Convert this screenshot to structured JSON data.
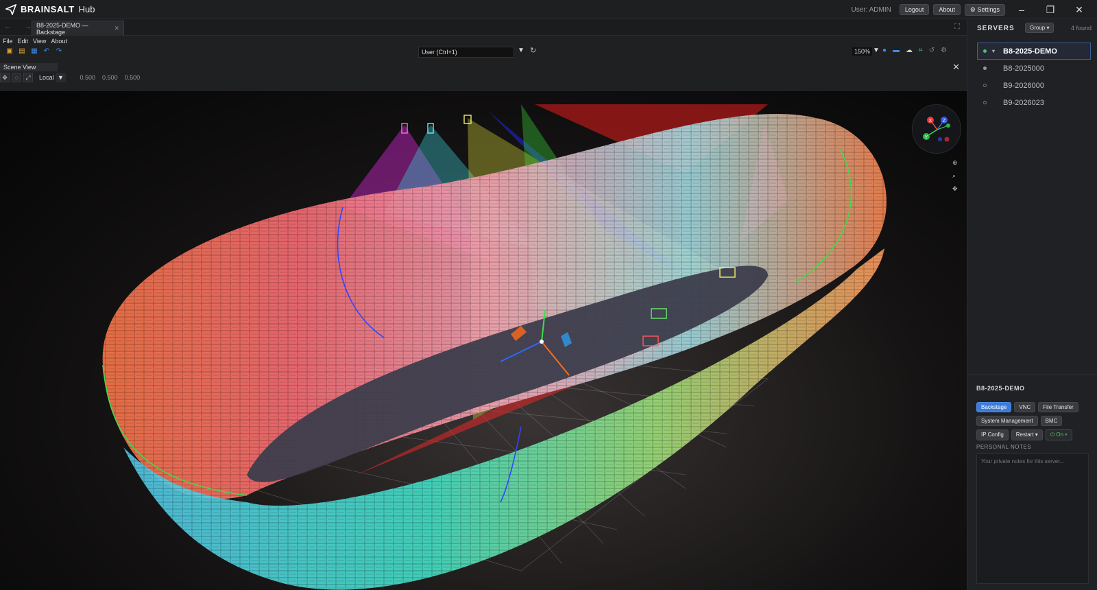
{
  "app": {
    "brand_bold": "BRAINSALT",
    "brand_light": "Hub"
  },
  "titlebar": {
    "user": "User: ADMIN",
    "logout": "Logout",
    "about": "About",
    "settings": "Settings",
    "min": "–",
    "max": "❐",
    "close": "✕"
  },
  "tabs": {
    "nav": "← →",
    "active": "B8-2025-DEMO — Backstage",
    "close": "✕",
    "fullscreen": "⛶"
  },
  "menu": {
    "file": "File",
    "edit": "Edit",
    "view": "View",
    "about": "About"
  },
  "toolbar": {
    "camera_value": "User  (Ctrl+1)",
    "zoom": "150%"
  },
  "scene": {
    "title": "Scene View",
    "space": "Local",
    "values": [
      "0.500",
      "0.500",
      "0.500"
    ]
  },
  "gizmo": {
    "x": "X",
    "y": "Y",
    "z": "Z"
  },
  "sidebar": {
    "header": "SERVERS",
    "group": "Group",
    "found": "4 found",
    "servers": [
      {
        "name": "B8-2025-DEMO",
        "status_color": "#4fc36b"
      },
      {
        "name": "B8-2025000",
        "status_color": "#9a9a9a"
      },
      {
        "name": "B9-2026000",
        "status_color": "#6a6a6a"
      },
      {
        "name": "B9-2026023",
        "status_color": "#6a6a6a"
      }
    ]
  },
  "detail": {
    "title": "B8-2025-DEMO",
    "buttons": {
      "backstage": "Backstage",
      "vnc": "VNC",
      "file_transfer": "File Transfer",
      "system_management": "System Management",
      "bmc": "BMC",
      "ip_config": "IP Config",
      "restart": "Restart",
      "on": "On"
    },
    "notes_label": "PERSONAL NOTES",
    "notes_placeholder": "Your private notes for this server..."
  }
}
